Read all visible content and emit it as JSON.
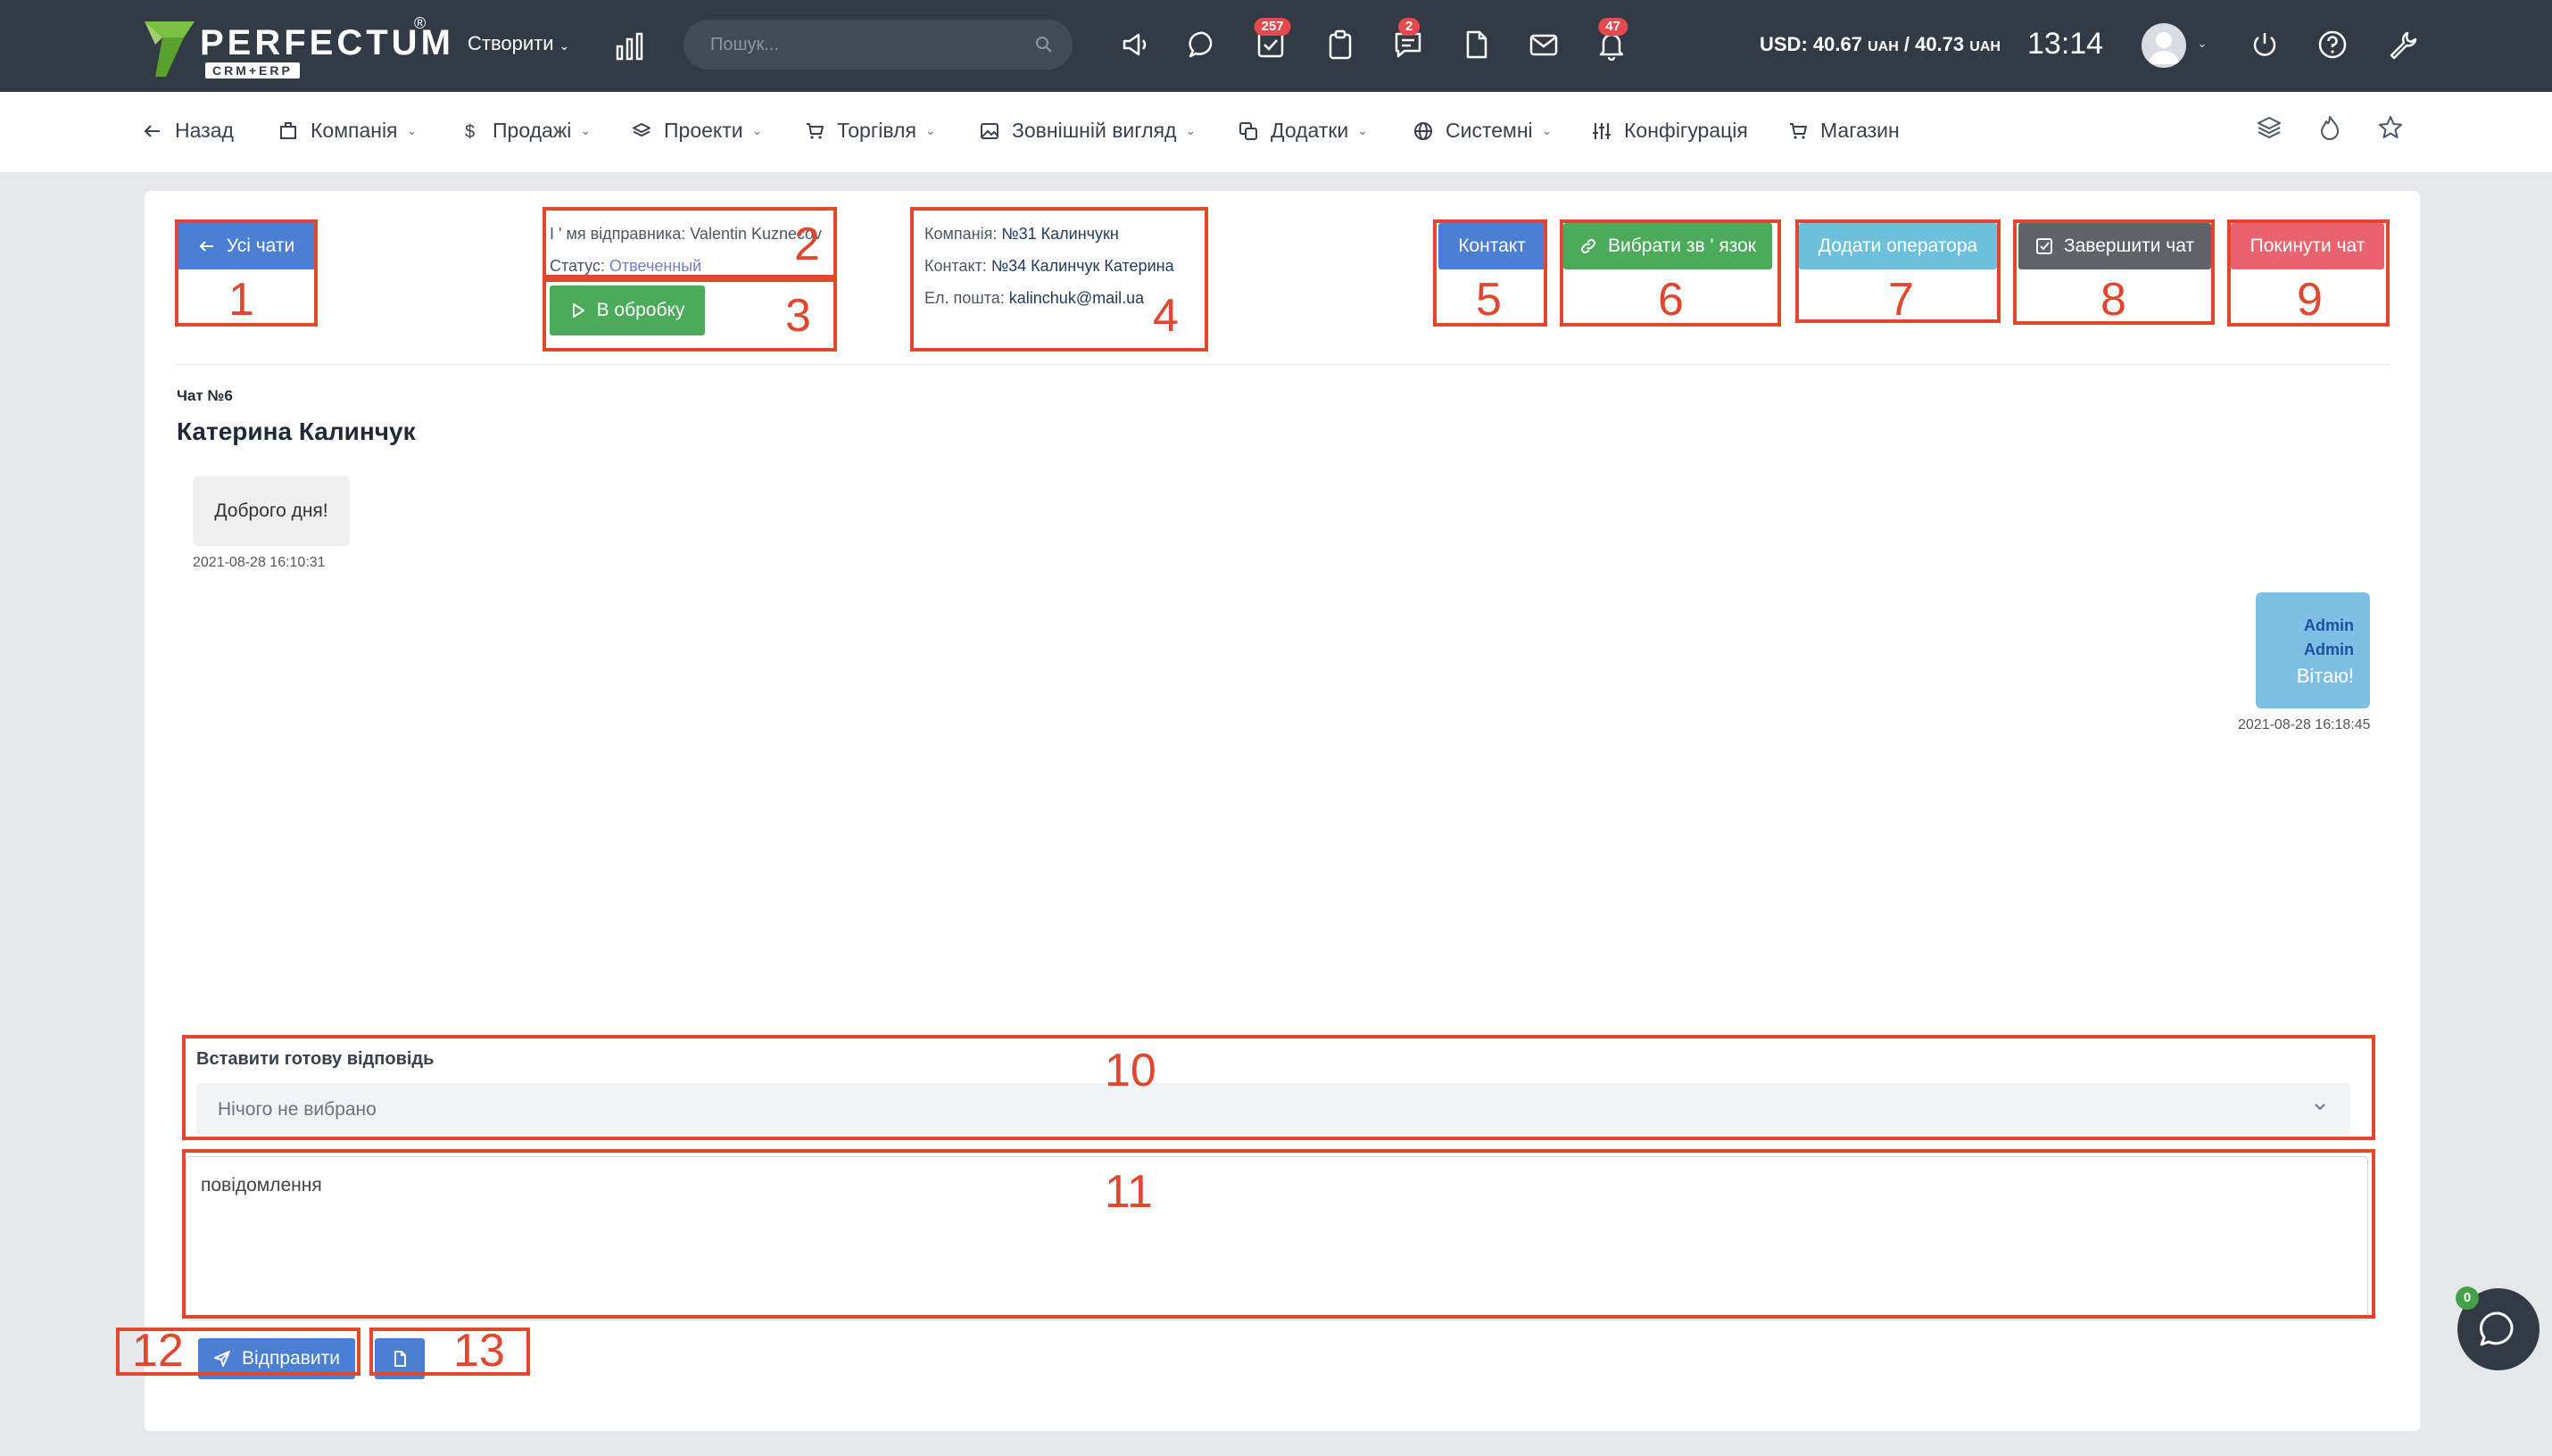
{
  "topbar": {
    "logo_text": "PERFECTUM",
    "logo_sup": "®",
    "logo_sub": "CRM+ERP",
    "create_label": "Створити",
    "search_placeholder": "Пошук...",
    "badges": {
      "tasks": "257",
      "chat": "2",
      "notifications": "47"
    },
    "currency_prefix": "USD: 40.67",
    "currency_unit_1": "UAH",
    "currency_mid": " / 40.73",
    "currency_unit_2": "UAH",
    "time": "13:14"
  },
  "nav": {
    "back": "Назад",
    "company": "Компанія",
    "sales": "Продажі",
    "projects": "Проекти",
    "trade": "Торгівля",
    "appearance": "Зовнішній вигляд",
    "addons": "Додатки",
    "system": "Системні",
    "config": "Конфігурація",
    "shop": "Магазин"
  },
  "header": {
    "all_chats": "Усі чати",
    "sender_label": "І ' мя відправника:",
    "sender_name": "Valentin Kuznecov",
    "status_label": "Статус:",
    "status_value": "Отвеченный",
    "process_btn": "В обробку",
    "company_label": "Компанія:",
    "company_value": "№31 Калинчукн",
    "contact_label": "Контакт:",
    "contact_value": "№34 Калинчук Катерина",
    "email_label": "Ел. пошта:",
    "email_value": "kalinchuk@mail.ua",
    "contact_btn": "Контакт",
    "link_btn": "Вибрати зв ' язок",
    "add_operator_btn": "Додати оператора",
    "finish_btn": "Завершити чат",
    "leave_btn": "Покинути чат"
  },
  "chat": {
    "number": "Чат №6",
    "title": "Катерина Калинчук",
    "messages": [
      {
        "text": "Доброго дня!",
        "time": "2021-08-28 16:10:31"
      },
      {
        "author_1": "Admin",
        "author_2": "Admin",
        "text": "Вітаю!",
        "time": "2021-08-28 16:18:45"
      }
    ]
  },
  "reply": {
    "label": "Вставити готову відповідь",
    "selected": "Нічого не вибрано",
    "message_placeholder": "повідомлення",
    "send_btn": "Відправити"
  },
  "annotations": [
    "1",
    "2",
    "3",
    "4",
    "5",
    "6",
    "7",
    "8",
    "9",
    "10",
    "11",
    "12",
    "13"
  ],
  "fab": {
    "count": "0"
  },
  "colors": {
    "topbar": "#323a45",
    "primary": "#4a7fd4",
    "success": "#4bab5a",
    "info": "#6cc0dc",
    "dark": "#5f6369",
    "danger": "#e8636e",
    "annotation": "#e1462f"
  }
}
